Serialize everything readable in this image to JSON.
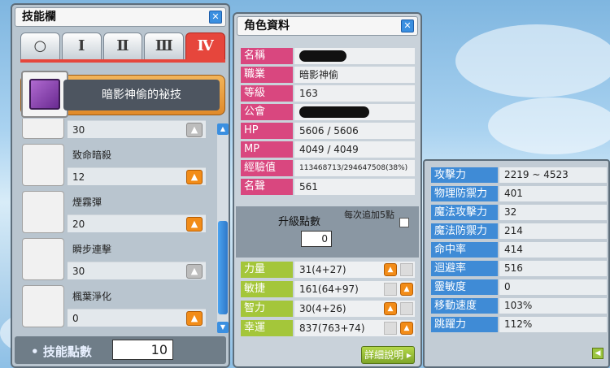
{
  "skill_window": {
    "title": "技能欄",
    "tabs": [
      "○",
      "Ⅰ",
      "Ⅱ",
      "Ⅲ",
      "Ⅳ"
    ],
    "book_label": "暗影神偷的祕技",
    "skills": [
      {
        "name": "",
        "level": "30",
        "up_enabled": false
      },
      {
        "name": "致命暗殺",
        "level": "12",
        "up_enabled": true
      },
      {
        "name": "煙霧彈",
        "level": "20",
        "up_enabled": true
      },
      {
        "name": "瞬步連擊",
        "level": "30",
        "up_enabled": false
      },
      {
        "name": "楓葉淨化",
        "level": "0",
        "up_enabled": true
      }
    ],
    "sp_label": "技能點數",
    "sp_value": "10"
  },
  "char_window": {
    "title": "角色資料",
    "info": [
      {
        "label": "名稱",
        "value": ""
      },
      {
        "label": "職業",
        "value": "暗影神偷"
      },
      {
        "label": "等級",
        "value": "163"
      },
      {
        "label": "公會",
        "value": ""
      },
      {
        "label": "HP",
        "value": "5606 / 5606"
      },
      {
        "label": "MP",
        "value": "4049 / 4049"
      },
      {
        "label": "經驗值",
        "value": "113468713/294647508(38%)"
      },
      {
        "label": "名聲",
        "value": "561"
      }
    ],
    "ap_label": "升級點數",
    "ap_value": "0",
    "auto_label": "每次追加5點",
    "stats": [
      {
        "label": "力量",
        "value": "31(4+27)"
      },
      {
        "label": "敏捷",
        "value": "161(64+97)"
      },
      {
        "label": "智力",
        "value": "30(4+26)"
      },
      {
        "label": "幸運",
        "value": "837(763+74)"
      }
    ],
    "detail_button": "詳細說明"
  },
  "detail_window": {
    "rows": [
      {
        "label": "攻擊力",
        "value": "2219 ~ 4523"
      },
      {
        "label": "物理防禦力",
        "value": "401"
      },
      {
        "label": "魔法攻擊力",
        "value": "32"
      },
      {
        "label": "魔法防禦力",
        "value": "214"
      },
      {
        "label": "命中率",
        "value": "414"
      },
      {
        "label": "迴避率",
        "value": "516"
      },
      {
        "label": "靈敏度",
        "value": "0"
      },
      {
        "label": "移動速度",
        "value": "103%"
      },
      {
        "label": "跳躍力",
        "value": "112%"
      }
    ]
  },
  "colors": {
    "info_label": "#d9477f",
    "stat_label": "#a4c63a",
    "detail_label": "#3f8bd6",
    "active_tab": "#e6463c",
    "up_button": "#f28c18"
  }
}
